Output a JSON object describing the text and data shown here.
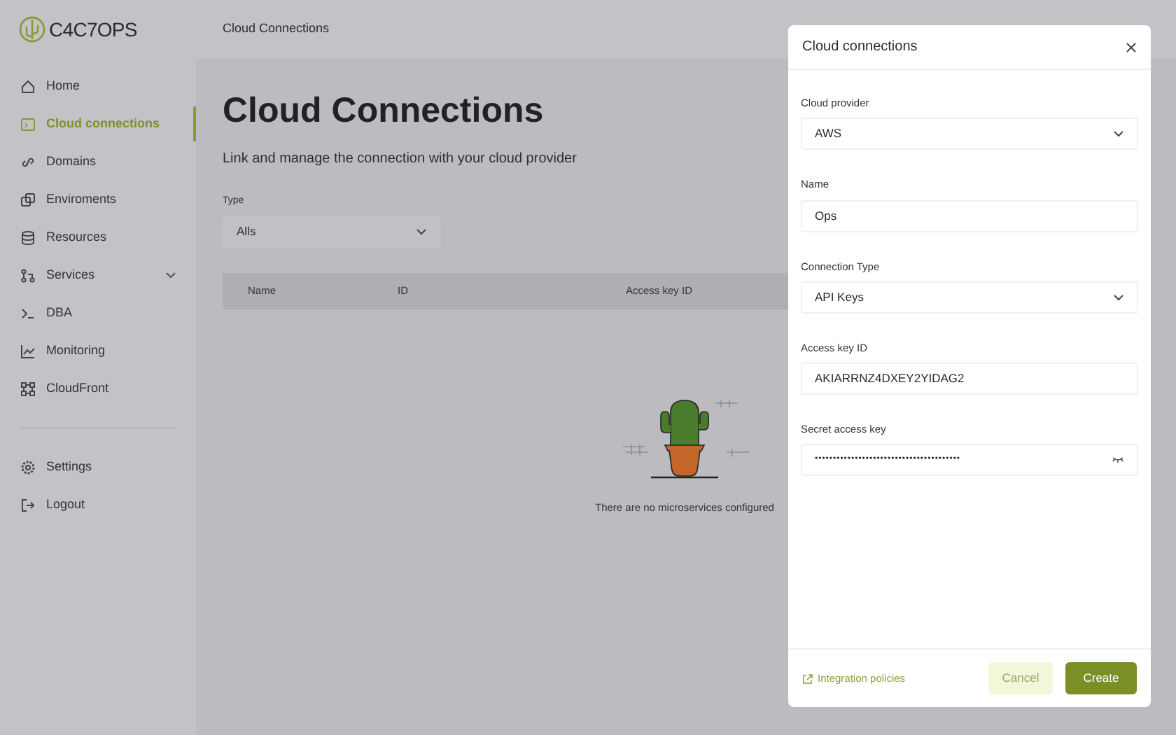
{
  "logo": {
    "text": "C4C7OPS"
  },
  "breadcrumb": "Cloud Connections",
  "sidebar": {
    "items": [
      {
        "label": "Home",
        "selected": false,
        "kind": "link"
      },
      {
        "label": "Cloud connections",
        "selected": true,
        "kind": "link"
      },
      {
        "label": "Domains",
        "selected": false,
        "kind": "link"
      },
      {
        "label": "Enviroments",
        "selected": false,
        "kind": "link"
      },
      {
        "label": "Resources",
        "selected": false,
        "kind": "link"
      },
      {
        "label": "Services",
        "selected": false,
        "kind": "group"
      },
      {
        "label": "DBA",
        "selected": false,
        "kind": "link"
      },
      {
        "label": "Monitoring",
        "selected": false,
        "kind": "link"
      },
      {
        "label": "CloudFront",
        "selected": false,
        "kind": "link"
      }
    ],
    "bottom_items": [
      {
        "label": "Settings"
      },
      {
        "label": "Logout"
      }
    ]
  },
  "page": {
    "title": "Cloud Connections",
    "subtitle": "Link and manage the connection with your cloud provider",
    "filter": {
      "label": "Type",
      "value": "Alls"
    },
    "table": {
      "columns": [
        "Name",
        "ID",
        "Access key ID"
      ]
    },
    "empty_message": "There are no microservices configured"
  },
  "modal": {
    "title": "Cloud connections",
    "fields": [
      {
        "label": "Cloud provider",
        "value": "AWS",
        "kind": "select"
      },
      {
        "label": "Name",
        "value": "Ops",
        "kind": "text"
      },
      {
        "label": "Connection Type",
        "value": "API Keys",
        "kind": "select"
      },
      {
        "label": "Access key ID",
        "value": "AKIARRNZ4DXEY2YIDAG2",
        "kind": "text"
      },
      {
        "label": "Secret access key",
        "value": "••••••••••••••••••••••••••••••••••••••••",
        "kind": "password"
      }
    ],
    "link": "Integration policies",
    "buttons": [
      {
        "label": "Cancel",
        "kind": "secondary"
      },
      {
        "label": "Create",
        "kind": "primary"
      }
    ]
  }
}
